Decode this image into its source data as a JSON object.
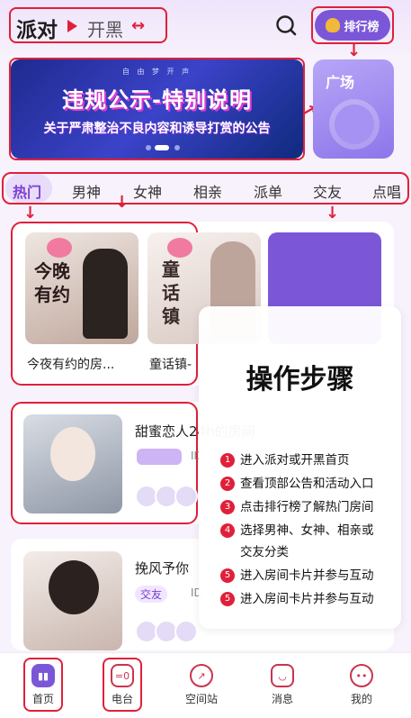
{
  "header": {
    "title": "派对",
    "subtitle": "开黑",
    "rank_label": "排行榜"
  },
  "banner": {
    "small": "自 由 梦 开 声",
    "title": "违规公示-特别说明",
    "subtitle": "关于严肃整治不良内容和诱导打赏的公告"
  },
  "square": {
    "label": "广场"
  },
  "tabs": [
    "热门",
    "男神",
    "女神",
    "相亲",
    "派单",
    "交友",
    "点唱"
  ],
  "rooms_grid": [
    {
      "title": "今夜有约的房...",
      "thumb_text": "今晚有约"
    },
    {
      "title": "童话镇-",
      "thumb_text": "童话镇"
    }
  ],
  "rooms_list": [
    {
      "title": "甜蜜恋人24h的房间",
      "tag": "",
      "side_id": "ID"
    },
    {
      "title": "挽风予你",
      "tag": "交友",
      "side_id": "ID"
    }
  ],
  "steps": {
    "title": "操作步骤",
    "items": [
      {
        "num": "1",
        "text": "进入派对或开黑首页"
      },
      {
        "num": "2",
        "text": "查看顶部公告和活动入口"
      },
      {
        "num": "3",
        "text": "点击排行榜了解热门房间"
      },
      {
        "num": "4",
        "text": "选择男神、女神、相亲或"
      },
      {
        "num": "",
        "text": "交友分类"
      },
      {
        "num": "5",
        "text": "进入房间卡片并参与互动"
      },
      {
        "num": "5",
        "text": "进入房间卡片并参与互动"
      }
    ]
  },
  "nav": [
    "首页",
    "电台",
    "空间站",
    "消息",
    "我的"
  ],
  "colors": {
    "accent": "#e0203a",
    "brand": "#7b57d8"
  }
}
